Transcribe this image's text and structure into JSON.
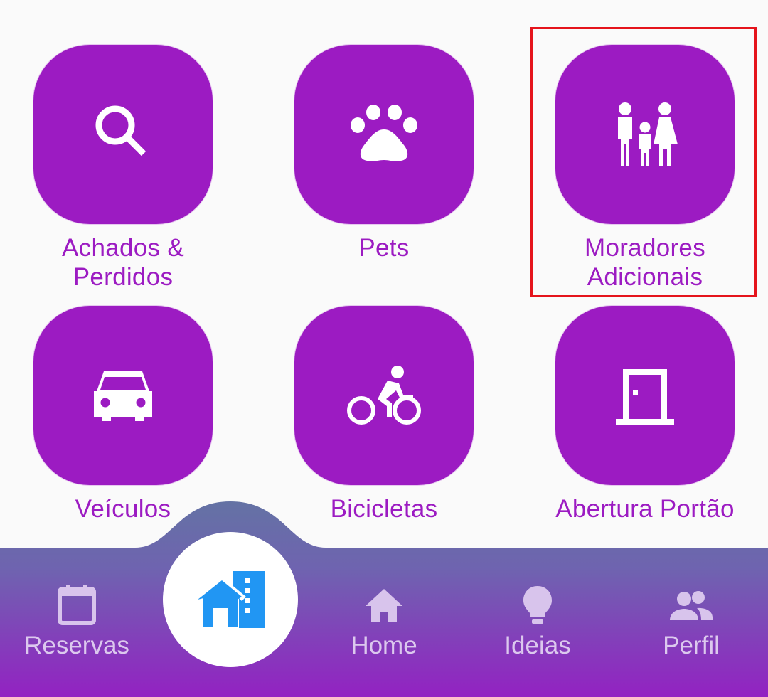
{
  "tiles": [
    {
      "label": "Achados & Perdidos",
      "icon": "search-icon"
    },
    {
      "label": "Pets",
      "icon": "paw-icon"
    },
    {
      "label": "Moradores Adicionais",
      "icon": "family-icon"
    },
    {
      "label": "Veículos",
      "icon": "car-icon"
    },
    {
      "label": "Bicicletas",
      "icon": "bicycle-icon"
    },
    {
      "label": "Abertura Portão",
      "icon": "door-icon"
    }
  ],
  "tile_labels_split": {
    "achados_line1": "Achados &",
    "achados_line2": "Perdidos",
    "moradores_line1": "Moradores",
    "moradores_line2": "Adicionais"
  },
  "bottom_nav": {
    "reservas": "Reservas",
    "home": "Home",
    "ideias": "Ideias",
    "perfil": "Perfil",
    "fab_icon": "building-home-icon"
  },
  "colors": {
    "tile_purple": "#9c1bc2",
    "nav_top": "#6472a4",
    "nav_bottom": "#9322c2",
    "fab_icon_blue": "#2196f3",
    "highlight_red": "#e5141c"
  }
}
